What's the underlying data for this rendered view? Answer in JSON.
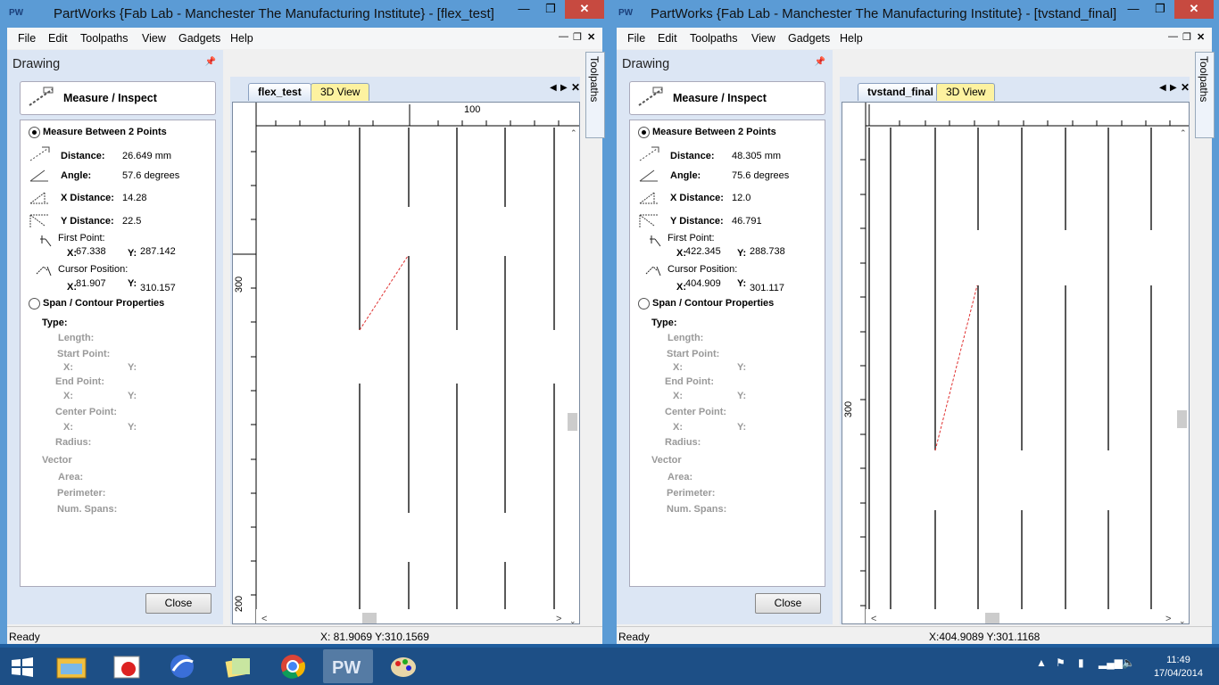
{
  "left": {
    "title": "PartWorks {Fab Lab - Manchester The Manufacturing Institute} - [flex_test]",
    "app_icon": "PW",
    "menus": [
      "File",
      "Edit",
      "Toolpaths",
      "View",
      "Gadgets",
      "Help"
    ],
    "panel_title": "Drawing",
    "mi_title": "Measure / Inspect",
    "mode1": "Measure Between 2 Points",
    "distance_label": "Distance:",
    "distance": "26.649 mm",
    "angle_label": "Angle:",
    "angle": "57.6 degrees",
    "xdist_label": "X Distance:",
    "xdist": "14.28",
    "ydist_label": "Y Distance:",
    "ydist": "22.5",
    "first_label": "First Point:",
    "fx_label": "X:",
    "fx": "67.338",
    "fy_label": "Y:",
    "fy": "287.142",
    "cursor_label": "Cursor Position:",
    "cx_label": "X:",
    "cx": "81.907",
    "cy_label": "Y:",
    "cy": "310.157",
    "mode2": "Span / Contour Properties",
    "type_label": "Type:",
    "length_label": "Length:",
    "start_label": "Start Point:",
    "end_label": "End Point:",
    "center_label": "Center Point:",
    "x_label": "X:",
    "y_label": "Y:",
    "radius_label": "Radius:",
    "vector_label": "Vector",
    "area_label": "Area:",
    "perimeter_label": "Perimeter:",
    "numspans_label": "Num. Spans:",
    "close_btn": "Close",
    "tab_active": "flex_test",
    "tab_3d": "3D View",
    "ruler_top": "100",
    "ruler_left_a": "300",
    "ruler_left_b": "200",
    "side_label": "Toolpaths",
    "status_ready": "Ready",
    "status_coords": "X: 81.9069 Y:310.1569"
  },
  "right": {
    "title": "PartWorks {Fab Lab - Manchester The Manufacturing Institute} - [tvstand_final]",
    "app_icon": "PW",
    "menus": [
      "File",
      "Edit",
      "Toolpaths",
      "View",
      "Gadgets",
      "Help"
    ],
    "panel_title": "Drawing",
    "mi_title": "Measure / Inspect",
    "mode1": "Measure Between 2 Points",
    "distance_label": "Distance:",
    "distance": "48.305 mm",
    "angle_label": "Angle:",
    "angle": "75.6 degrees",
    "xdist_label": "X Distance:",
    "xdist": "12.0",
    "ydist_label": "Y Distance:",
    "ydist": "46.791",
    "first_label": "First Point:",
    "fx_label": "X:",
    "fx": "422.345",
    "fy_label": "Y:",
    "fy": "288.738",
    "cursor_label": "Cursor Position:",
    "cx_label": "X:",
    "cx": "404.909",
    "cy_label": "Y:",
    "cy": "301.117",
    "mode2": "Span / Contour Properties",
    "type_label": "Type:",
    "length_label": "Length:",
    "start_label": "Start Point:",
    "end_label": "End Point:",
    "center_label": "Center Point:",
    "x_label": "X:",
    "y_label": "Y:",
    "radius_label": "Radius:",
    "vector_label": "Vector",
    "area_label": "Area:",
    "perimeter_label": "Perimeter:",
    "numspans_label": "Num. Spans:",
    "close_btn": "Close",
    "tab_active": "tvstand_final",
    "tab_3d": "3D View",
    "ruler_left_a": "300",
    "side_label": "Toolpaths",
    "status_ready": "Ready",
    "status_coords": "X:404.9089 Y:301.1168"
  },
  "taskbar": {
    "items": [
      "file-explorer-icon",
      "photo-app-icon",
      "flash-app-icon",
      "sticky-notes-icon",
      "chrome-icon",
      "partworks-icon",
      "paint-icon"
    ],
    "clock_time": "11:49",
    "clock_date": "17/04/2014",
    "pw_label": "PW"
  },
  "colors": {
    "title_bg": "#5b9bd5",
    "close_red": "#c74a40",
    "panel_bg": "#dce6f4",
    "tab_3d": "#fdf2a0",
    "measure_line": "#e03030",
    "taskbar": "#1d4f86"
  }
}
